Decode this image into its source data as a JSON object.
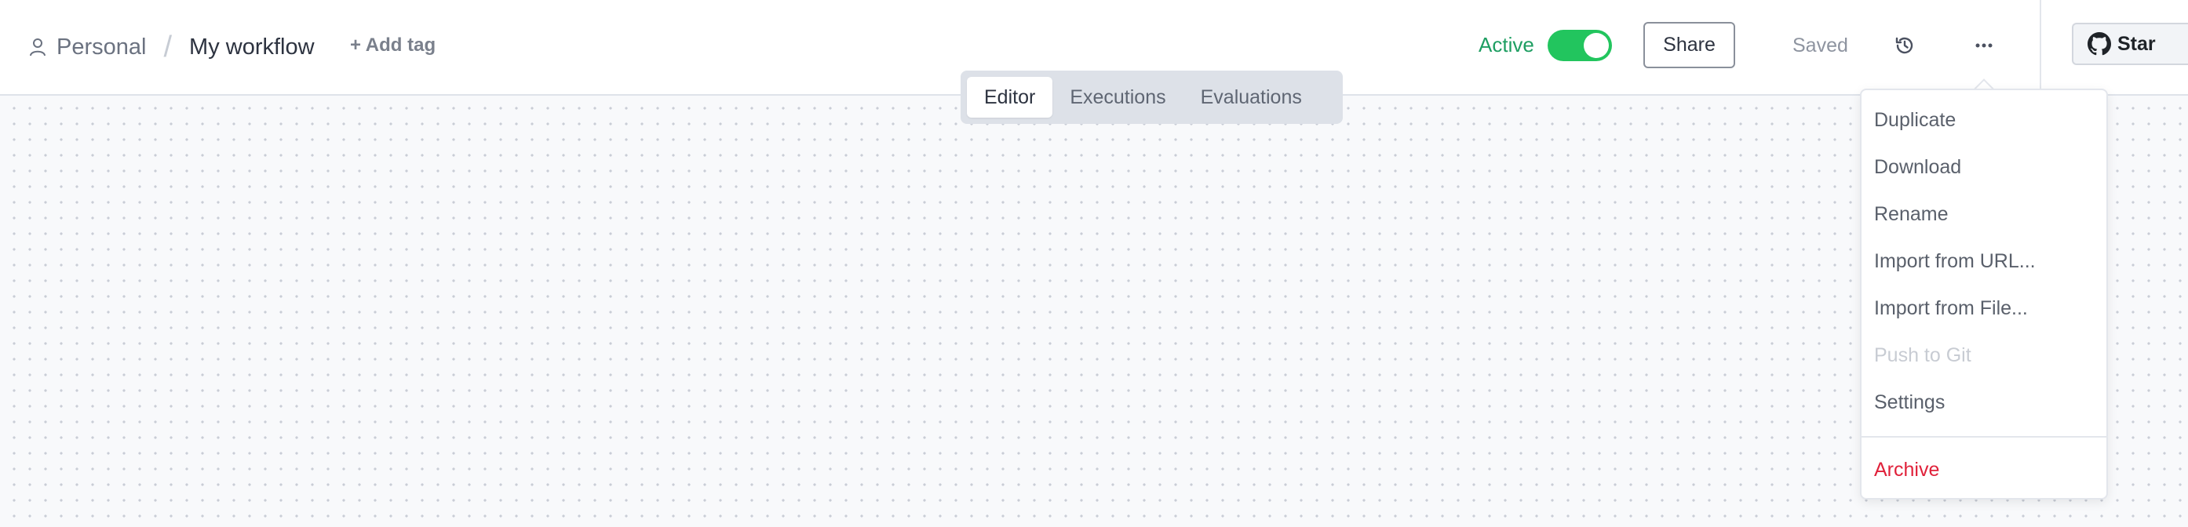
{
  "breadcrumb": {
    "project": "Personal",
    "separator": "/",
    "workflow_name": "My workflow",
    "add_tag": "+ Add tag"
  },
  "tabs": [
    {
      "label": "Editor",
      "active": true
    },
    {
      "label": "Executions",
      "active": false
    },
    {
      "label": "Evaluations",
      "active": false
    }
  ],
  "header": {
    "active_label": "Active",
    "active_toggle_on": true,
    "share_label": "Share",
    "saved_label": "Saved",
    "history_icon": "history-icon",
    "more_icon": "more-horizontal-icon",
    "github_star_label": "Star"
  },
  "menu": {
    "items": [
      {
        "label": "Duplicate",
        "state": "enabled"
      },
      {
        "label": "Download",
        "state": "enabled"
      },
      {
        "label": "Rename",
        "state": "enabled"
      },
      {
        "label": "Import from URL...",
        "state": "enabled"
      },
      {
        "label": "Import from File...",
        "state": "enabled"
      },
      {
        "label": "Push to Git",
        "state": "disabled"
      },
      {
        "label": "Settings",
        "state": "enabled"
      }
    ],
    "danger_item": {
      "label": "Archive",
      "state": "danger"
    }
  },
  "colors": {
    "active_green": "#1e9e62",
    "toggle_green": "#22c55e",
    "danger_red": "#e0213a",
    "canvas_bg": "#f8f9fb"
  }
}
